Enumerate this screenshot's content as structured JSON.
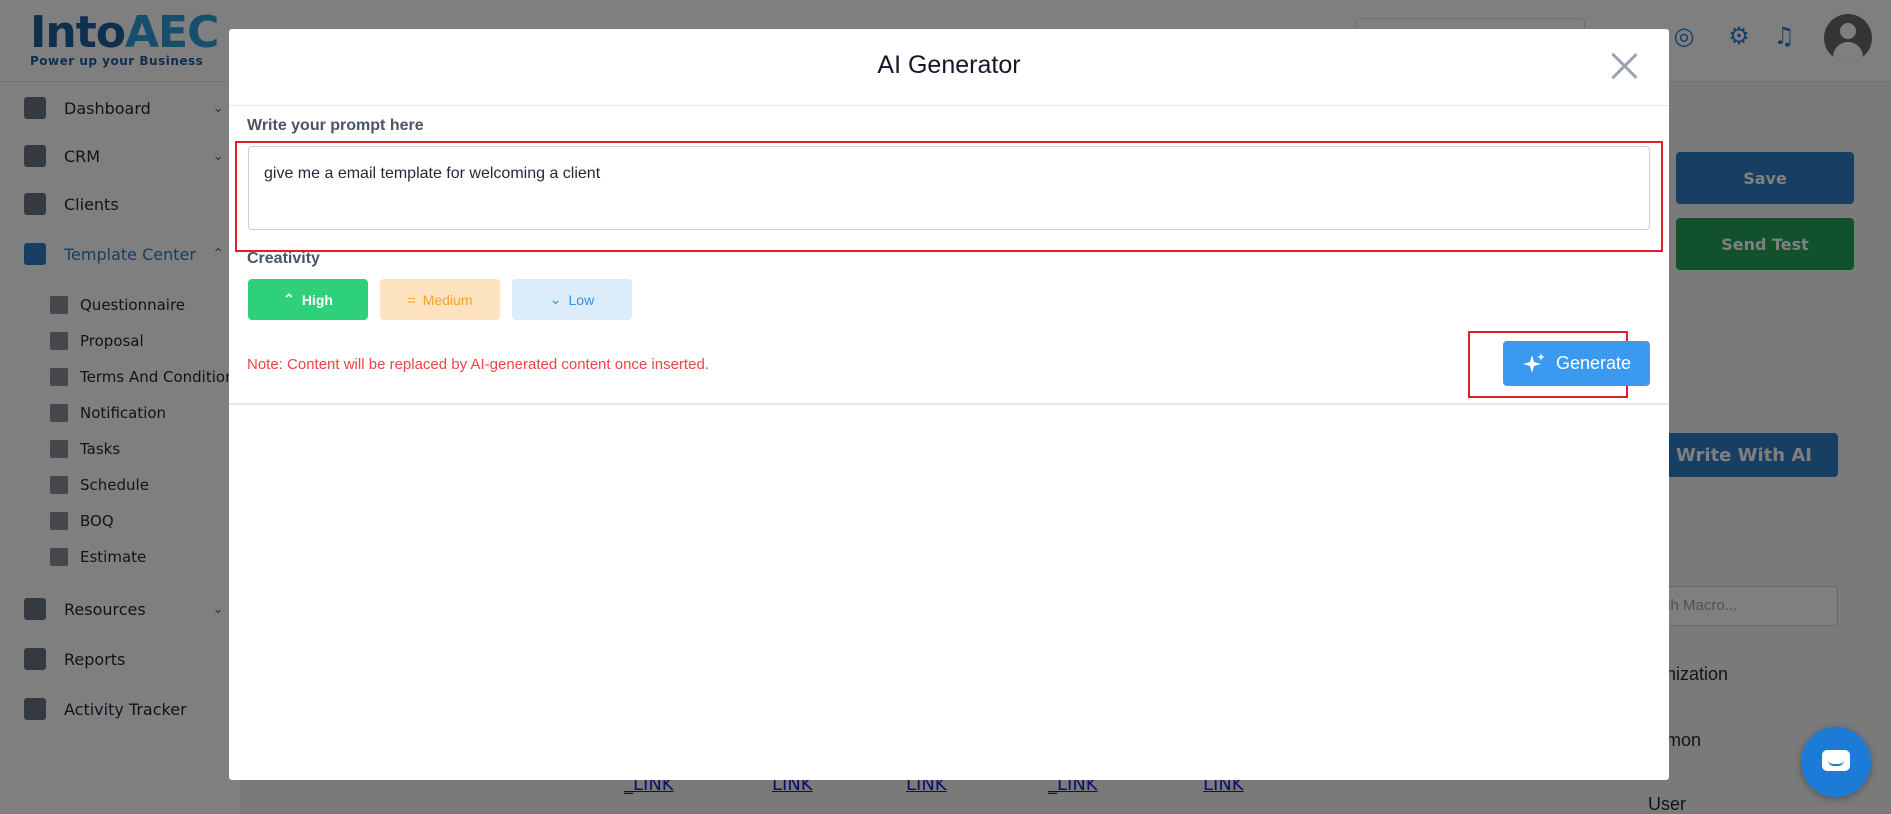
{
  "brand": {
    "name_part1": "Into",
    "name_part2": "AEC",
    "tagline": "Power up your Business"
  },
  "sidebar": {
    "items": [
      {
        "label": "Dashboard",
        "icon": "dashboard-icon"
      },
      {
        "label": "CRM",
        "icon": "crm-icon"
      },
      {
        "label": "Clients",
        "icon": "clients-icon"
      },
      {
        "label": "Template Center",
        "icon": "template-icon"
      },
      {
        "label": "Resources",
        "icon": "resources-icon"
      },
      {
        "label": "Reports",
        "icon": "reports-icon"
      },
      {
        "label": "Activity Tracker",
        "icon": "activity-icon"
      }
    ],
    "subitems": [
      {
        "label": "Questionnaire"
      },
      {
        "label": "Proposal"
      },
      {
        "label": "Terms And Conditions"
      },
      {
        "label": "Notification"
      },
      {
        "label": "Tasks"
      },
      {
        "label": "Schedule"
      },
      {
        "label": "BOQ"
      },
      {
        "label": "Estimate"
      }
    ]
  },
  "background": {
    "save_label": "Save",
    "send_test_label": "Send Test",
    "write_ai_label": "Write With AI",
    "macro_placeholder": "ch Macro...",
    "panel_items": [
      "nization",
      "mon",
      "User"
    ],
    "links": [
      "_LINK",
      "LINK",
      "LINK",
      "_LINK",
      "LINK"
    ]
  },
  "modal": {
    "title": "AI Generator",
    "prompt_label": "Write your prompt here",
    "prompt_value": "give me a email template for welcoming a client",
    "creativity_label": "Creativity",
    "creativity_options": [
      {
        "label": "High",
        "glyph": "⌃"
      },
      {
        "label": "Medium",
        "glyph": "="
      },
      {
        "label": "Low",
        "glyph": "⌄"
      }
    ],
    "note": "Note: Content will be replaced by AI-generated content once inserted.",
    "generate_label": "Generate"
  },
  "colors": {
    "accent": "#3b9af0",
    "high": "#2fd07a",
    "medium_bg": "#fde3bf",
    "low_bg": "#dcecfb",
    "note": "#ef4444",
    "highlight": "#e11d2b"
  }
}
